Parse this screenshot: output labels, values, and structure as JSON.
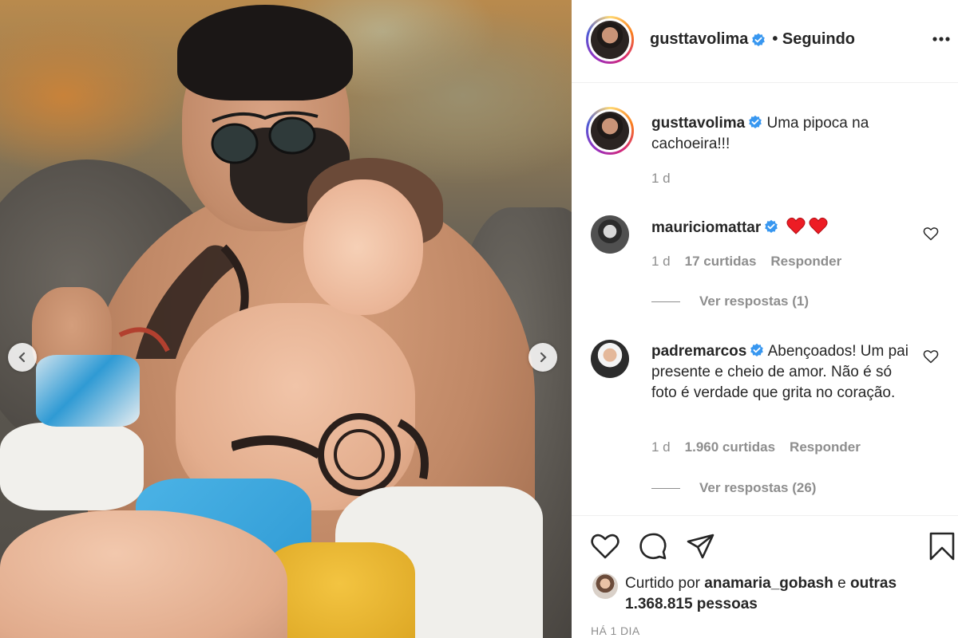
{
  "post": {
    "photo_alt": "",
    "header": {
      "username": "gusttavolima",
      "follow_status": "• Seguindo"
    },
    "caption": {
      "username": "gusttavolima",
      "text": "Uma pipoca na cachoeira!!!",
      "time": "1 d"
    },
    "comments": [
      {
        "username": "mauriciomattar",
        "text": "",
        "icon": "red-heart-emoji x2",
        "time": "1 d",
        "likes": "17 curtidas",
        "reply_label": "Responder",
        "view_replies": "Ver respostas (1)"
      },
      {
        "username": "padremarcos",
        "text": "Abençoados! Um pai presente e cheio de amor. Não é só foto é verdade que grita no coração.",
        "time": "1 d",
        "likes": "1.960 curtidas",
        "reply_label": "Responder",
        "view_replies": "Ver respostas (26)"
      }
    ],
    "likes": {
      "prefix": "Curtido por",
      "user": "anamaria_gobash",
      "joiner": "e",
      "others": "outras 1.368.815 pessoas"
    },
    "time_ago": "HÁ 1 DIA"
  },
  "colors": {
    "verified": "#3897f0",
    "heart_red": "#ed4956",
    "text": "#262626",
    "muted": "#8e8e8e"
  }
}
